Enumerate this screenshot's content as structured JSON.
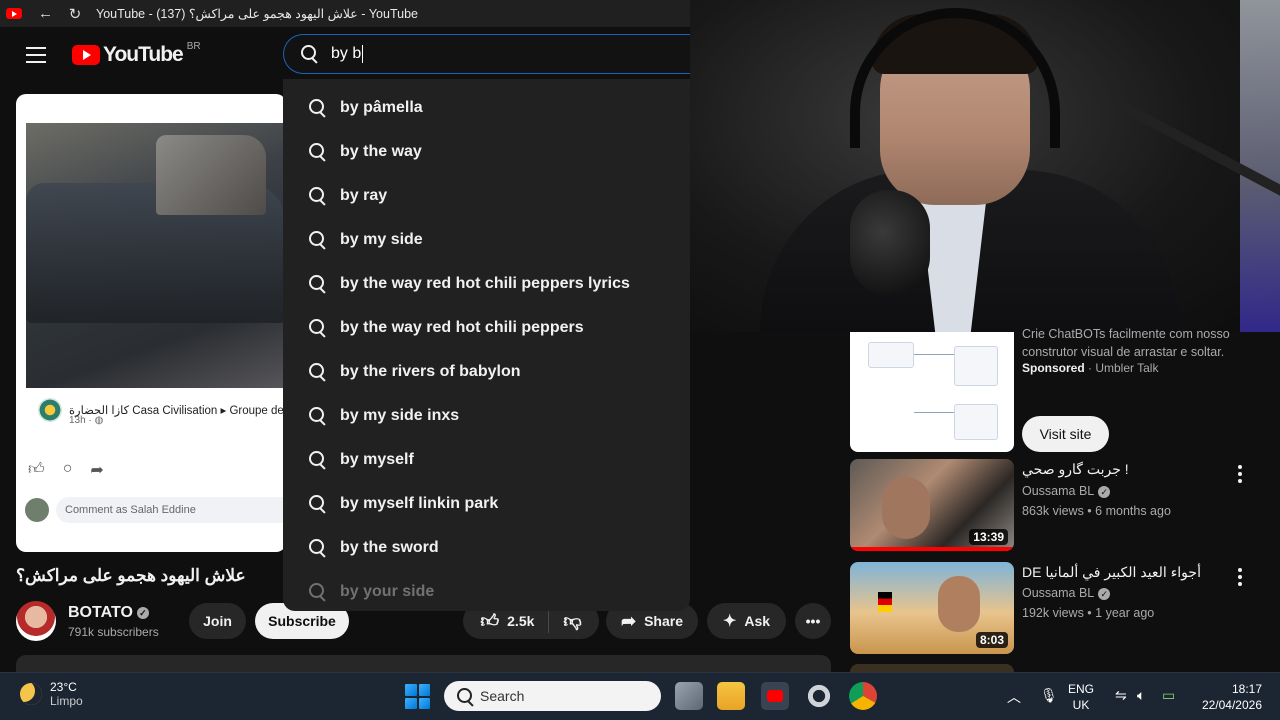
{
  "browser": {
    "tab_title": "YouTube - (137) علاش اليهود هجمو على مراكش؟ - YouTube",
    "back_icon": "back-arrow-icon",
    "reload_icon": "reload-icon"
  },
  "youtube": {
    "logo_text": "YouTube",
    "country_code": "BR",
    "search": {
      "value": "by b",
      "suggestions": [
        "by pâmella",
        "by the way",
        "by ray",
        "by my side",
        "by the way red hot chili peppers lyrics",
        "by the way red hot chili peppers",
        "by the rivers of babylon",
        "by my side inxs",
        "by myself",
        "by myself linkin park",
        "by the sword",
        "by your side"
      ]
    }
  },
  "post": {
    "page_name": "كازا الحضارة Casa Civilisation ▸ Groupe de",
    "time": "13h · ◍",
    "comment_placeholder": "Comment as Salah Eddine"
  },
  "video": {
    "title": "علاش اليهود هجمو على مراكش؟",
    "channel_name": "BOTATO",
    "subscribers": "791k subscribers",
    "join_label": "Join",
    "subscribe_label": "Subscribe",
    "likes": "2.5k",
    "share_label": "Share",
    "ask_label": "Ask"
  },
  "sidebar": {
    "ad": {
      "text": "Crie ChatBOTs facilmente com nosso construtor visual de arrastar e soltar.",
      "sponsored_label": "Sponsored",
      "advertiser": "Umbler Talk",
      "cta": "Visit site"
    },
    "videos": [
      {
        "title": "جربت گارو صحي !",
        "channel": "Oussama BL",
        "meta": "863k views • 6 months ago",
        "duration": "13:39"
      },
      {
        "title": "DE أجواء العيد الكبير في ألمانيا",
        "channel": "Oussama BL",
        "meta": "192k views • 1 year ago",
        "duration": "8:03"
      }
    ]
  },
  "taskbar": {
    "temperature": "23°C",
    "condition": "Limpo",
    "search_placeholder": "Search",
    "language": "ENG",
    "region": "UK",
    "time": "18:17",
    "date": "22/04/2026"
  }
}
